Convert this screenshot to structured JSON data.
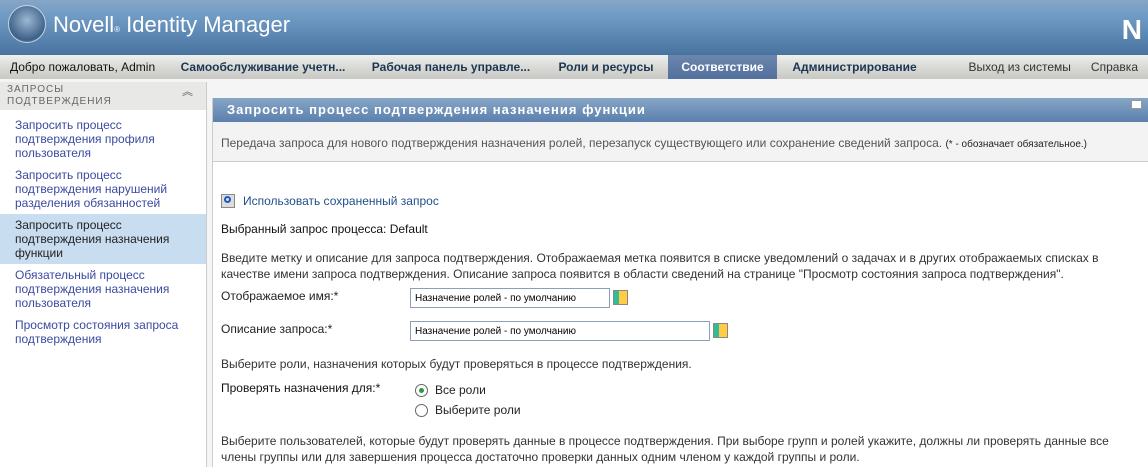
{
  "header": {
    "brand": "Novell",
    "reg": "®",
    "product": "Identity Manager",
    "corner_logo": "N"
  },
  "nav": {
    "welcome": "Добро пожаловать, Admin",
    "tabs": [
      "Самообслуживание учетн...",
      "Рабочая панель управле...",
      "Роли и ресурсы",
      "Соответствие",
      "Администрирование"
    ],
    "active_tab": "Соответствие",
    "logout": "Выход из системы",
    "help": "Справка"
  },
  "sidebar": {
    "title": "ЗАПРОСЫ ПОДТВЕРЖДЕНИЯ",
    "items": [
      {
        "label": "Запросить процесс подтверждения профиля пользователя"
      },
      {
        "label": "Запросить процесс подтверждения нарушений разделения обязанностей"
      },
      {
        "label": "Запросить процесс подтверждения назначения функции",
        "selected": true
      },
      {
        "label": "Обязательный процесс подтверждения назначения пользователя"
      },
      {
        "label": "Просмотр состояния запроса подтверждения"
      }
    ]
  },
  "main": {
    "title": "Запросить процесс подтверждения назначения функции",
    "description": "Передача запроса для нового подтверждения назначения ролей, перезапуск существующего или сохранение сведений запроса.",
    "required_note": "(* - обозначает обязательное.)",
    "use_saved": "Использовать сохраненный запрос",
    "selected_request": "Выбранный запрос процесса: Default",
    "intro": "Введите метку и описание для запроса подтверждения. Отображаемая метка появится в списке уведомлений о задачах и в других отображаемых списках в качестве имени запроса подтверждения. Описание запроса появится в области сведений на странице \"Просмотр состояния запроса подтверждения\".",
    "display_name_label": "Отображаемое имя:*",
    "display_name_value": "Назначение ролей - по умолчанию",
    "description_label": "Описание запроса:*",
    "description_value": "Назначение ролей - по умолчанию",
    "roles_intro": "Выберите роли, назначения которых будут проверяться в процессе подтверждения.",
    "check_for_label": "Проверять назначения для:*",
    "radio_all": "Все роли",
    "radio_select": "Выберите роли",
    "radio_selected": "Все роли",
    "users_intro": "Выберите пользователей, которые будут проверять данные в процессе подтверждения. При выборе групп и ролей укажите, должны ли проверять данные все члены группы или для завершения процесса достаточно проверки данных одним членом у каждой группы и роли."
  }
}
